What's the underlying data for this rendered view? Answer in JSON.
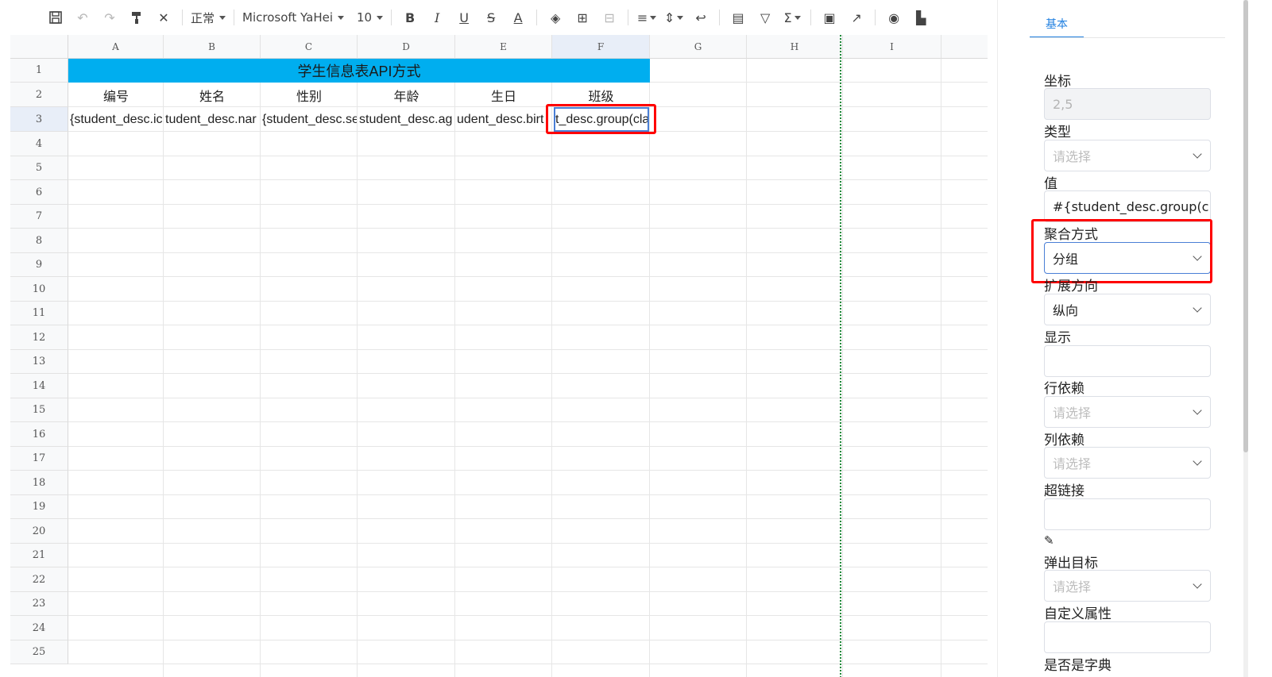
{
  "toolbar": {
    "style_label": "正常",
    "font_label": "Microsoft YaHei",
    "size_label": "10"
  },
  "columns": [
    "A",
    "B",
    "C",
    "D",
    "E",
    "F",
    "G",
    "H",
    "I"
  ],
  "rows": [
    "1",
    "2",
    "3",
    "4",
    "5",
    "6",
    "7",
    "8",
    "9",
    "10",
    "11",
    "12",
    "13",
    "14",
    "15",
    "16",
    "17",
    "18",
    "19",
    "20",
    "21",
    "22",
    "23",
    "24",
    "25"
  ],
  "sheet": {
    "title": "学生信息表API方式",
    "headers": [
      "编号",
      "姓名",
      "性别",
      "年龄",
      "生日",
      "班级"
    ],
    "row3": [
      "{student_desc.ic",
      "tudent_desc.nar",
      "{student_desc.se",
      "student_desc.ag",
      "udent_desc.birt",
      "t_desc.group(cla"
    ]
  },
  "panel": {
    "tab": "基本",
    "fields": {
      "coord_label": "坐标",
      "coord_value": "2,5",
      "type_label": "类型",
      "type_placeholder": "请选择",
      "value_label": "值",
      "value_value": "#{student_desc.group(cla",
      "agg_label": "聚合方式",
      "agg_value": "分组",
      "expand_label": "扩展方向",
      "expand_value": "纵向",
      "display_label": "显示",
      "rowdep_label": "行依赖",
      "rowdep_placeholder": "请选择",
      "coldep_label": "列依赖",
      "coldep_placeholder": "请选择",
      "link_label": "超链接",
      "popup_label": "弹出目标",
      "popup_placeholder": "请选择",
      "custom_label": "自定义属性",
      "dict_label": "是否是字典"
    }
  },
  "colors": {
    "title_fill": "#00aeef",
    "selection": "#4a7fd6",
    "highlight": "#ff0000",
    "accent": "#1f7fe0"
  }
}
